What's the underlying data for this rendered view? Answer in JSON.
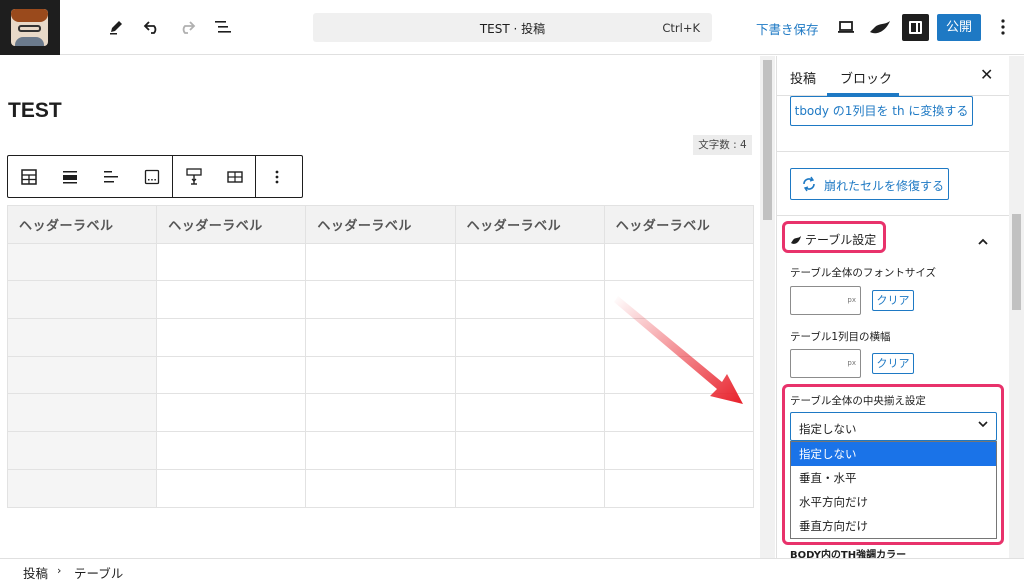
{
  "topbar": {
    "command_title": "TEST · 投稿",
    "command_shortcut": "Ctrl+K",
    "save_draft": "下書き保存",
    "publish": "公開"
  },
  "editor": {
    "post_title": "TEST",
    "word_count": "文字数 : 4",
    "table": {
      "headers": [
        "ヘッダーラベル",
        "ヘッダーラベル",
        "ヘッダーラベル",
        "ヘッダーラベル",
        "ヘッダーラベル"
      ],
      "body_rows": 7
    }
  },
  "sidebar": {
    "tabs": [
      "投稿",
      "ブロック"
    ],
    "active_tab": "ブロック",
    "convert_button": "tbody の1列目を th に変換する",
    "repair_button": "崩れたセルを修復する",
    "section_title": "テーブル設定",
    "font_size_label": "テーブル全体のフォントサイズ",
    "font_size_unit": "px",
    "col_width_label": "テーブル1列目の横幅",
    "col_width_unit": "px",
    "clear": "クリア",
    "align_label": "テーブル全体の中央揃え設定",
    "align_value": "指定しない",
    "align_options": [
      "指定しない",
      "垂直・水平",
      "水平方向だけ",
      "垂直方向だけ"
    ],
    "next_label": "BODY内のTH強調カラー"
  },
  "footer": {
    "breadcrumb": [
      "投稿",
      "テーブル"
    ]
  },
  "colors": {
    "accent": "#1e79c4",
    "highlight": "#e8326b",
    "arrow": "#e8202a"
  }
}
